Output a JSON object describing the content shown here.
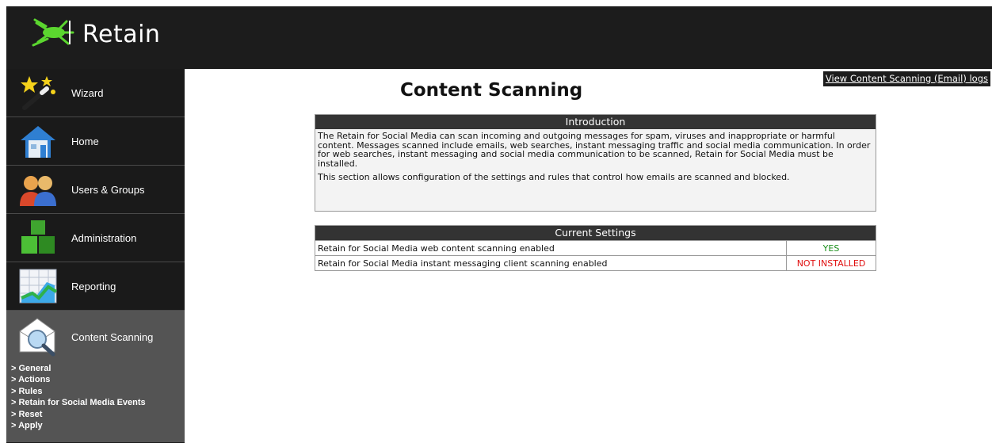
{
  "app": {
    "name": "Retain"
  },
  "header": {
    "logo_text": "Retain",
    "logo_icon": "cricket-logo-icon"
  },
  "sidebar": {
    "items": [
      {
        "label": "Wizard",
        "icon": "magic-wand-icon"
      },
      {
        "label": "Home",
        "icon": "house-icon"
      },
      {
        "label": "Users & Groups",
        "icon": "users-icon"
      },
      {
        "label": "Administration",
        "icon": "blocks-icon"
      },
      {
        "label": "Reporting",
        "icon": "chart-icon"
      },
      {
        "label": "Content Scanning",
        "icon": "envelope-magnifier-icon",
        "active": true
      }
    ],
    "subitems": [
      "> General",
      "> Actions",
      "> Rules",
      "> Retain for Social Media Events",
      "> Reset",
      "> Apply"
    ]
  },
  "main": {
    "log_link": "View Content Scanning (Email) logs",
    "title": "Content Scanning",
    "intro": {
      "heading": "Introduction",
      "paragraph1": "The Retain for Social Media can scan incoming and outgoing messages for spam, viruses and inappropriate or harmful content. Messages scanned include emails, web searches, instant messaging traffic and social media communication. In order for web searches, instant messaging and social media communication to be scanned, Retain for Social Media must be installed.",
      "paragraph2": "This section allows configuration of the settings and rules that control how emails are scanned and blocked."
    },
    "settings": {
      "heading": "Current Settings",
      "rows": [
        {
          "label": "Retain for Social Media web content scanning enabled",
          "value": "YES",
          "color": "#1b8f1b"
        },
        {
          "label": "Retain for Social Media instant messaging client scanning enabled",
          "value": "NOT INSTALLED",
          "color": "#e01010"
        }
      ]
    }
  }
}
